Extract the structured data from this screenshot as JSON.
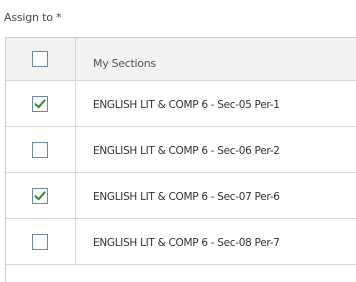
{
  "form": {
    "assign_label": "Assign to *"
  },
  "table": {
    "header_label": "My Sections",
    "header_checked": false,
    "rows": [
      {
        "label": "ENGLISH LIT & COMP 6 - Sec-05 Per-1",
        "checked": true
      },
      {
        "label": "ENGLISH LIT & COMP 6 - Sec-06 Per-2",
        "checked": false
      },
      {
        "label": "ENGLISH LIT & COMP 6 - Sec-07 Per-6",
        "checked": true
      },
      {
        "label": "ENGLISH LIT & COMP 6 - Sec-08 Per-7",
        "checked": false
      }
    ]
  },
  "colors": {
    "checkmark": "#2e8b2e",
    "checkbox_border": "#6a86a8",
    "header_bg": "#f2f2f2",
    "grid_line": "#d6d6d6"
  },
  "icons": {
    "check": "check-icon"
  }
}
